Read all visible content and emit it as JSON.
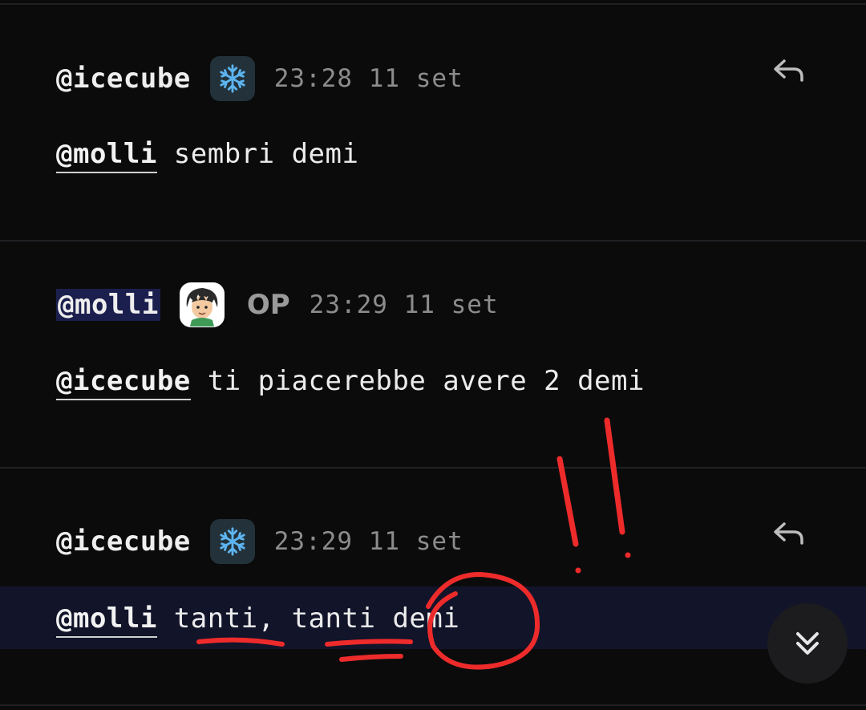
{
  "messages": [
    {
      "author": "@icecube",
      "badge_icon": "snowflake-icon",
      "time": "23:28 11 set",
      "mention": "@molli",
      "text": " sembri demi",
      "has_reply": true
    },
    {
      "author": "@molli",
      "badge_icon": "avatar-boy-icon",
      "op_label": "OP",
      "time": "23:29 11 set",
      "mention": "@icecube",
      "text": " ti piacerebbe avere 2 demi",
      "has_reply": false
    },
    {
      "author": "@icecube",
      "badge_icon": "snowflake-icon",
      "time": "23:29 11 set",
      "mention": "@molli",
      "text_parts": [
        " tanti",
        ",",
        " tanti",
        " demi"
      ],
      "has_reply": true
    }
  ],
  "colors": {
    "background": "#0b0b0c",
    "highlight": "#12142a",
    "annotation": "#ee2b2b",
    "snowflake": "#5db4f0"
  },
  "icons": {
    "reply": "reply-arrow-icon",
    "scroll_down": "double-chevron-down-icon"
  }
}
